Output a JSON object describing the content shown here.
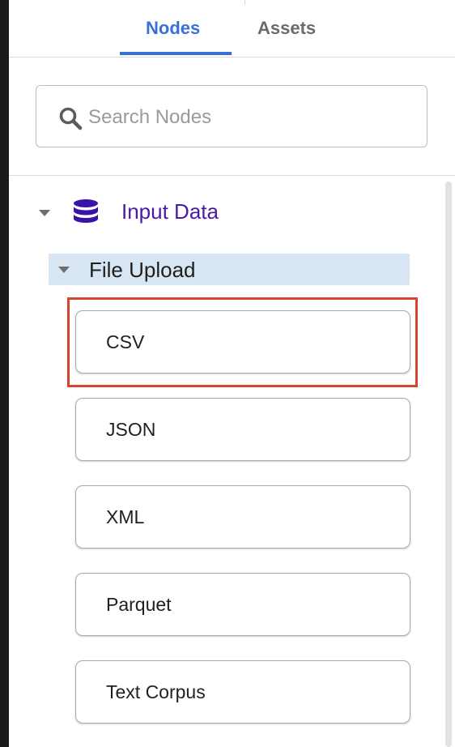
{
  "tabs": [
    {
      "label": "Nodes",
      "active": true
    },
    {
      "label": "Assets",
      "active": false
    }
  ],
  "search": {
    "placeholder": "Search Nodes",
    "value": ""
  },
  "tree": {
    "category": {
      "label": "Input Data",
      "icon": "database-icon",
      "expanded": true
    },
    "subcategory": {
      "label": "File Upload",
      "expanded": true
    },
    "nodes": [
      {
        "label": "CSV",
        "highlighted": true
      },
      {
        "label": "JSON",
        "highlighted": false
      },
      {
        "label": "XML",
        "highlighted": false
      },
      {
        "label": "Parquet",
        "highlighted": false
      },
      {
        "label": "Text Corpus",
        "highlighted": false
      }
    ]
  },
  "colors": {
    "accent": "#3a6fd8",
    "category_text": "#4a1aa6",
    "subcategory_bg": "#d8e5f3",
    "highlight": "#d9442e"
  }
}
